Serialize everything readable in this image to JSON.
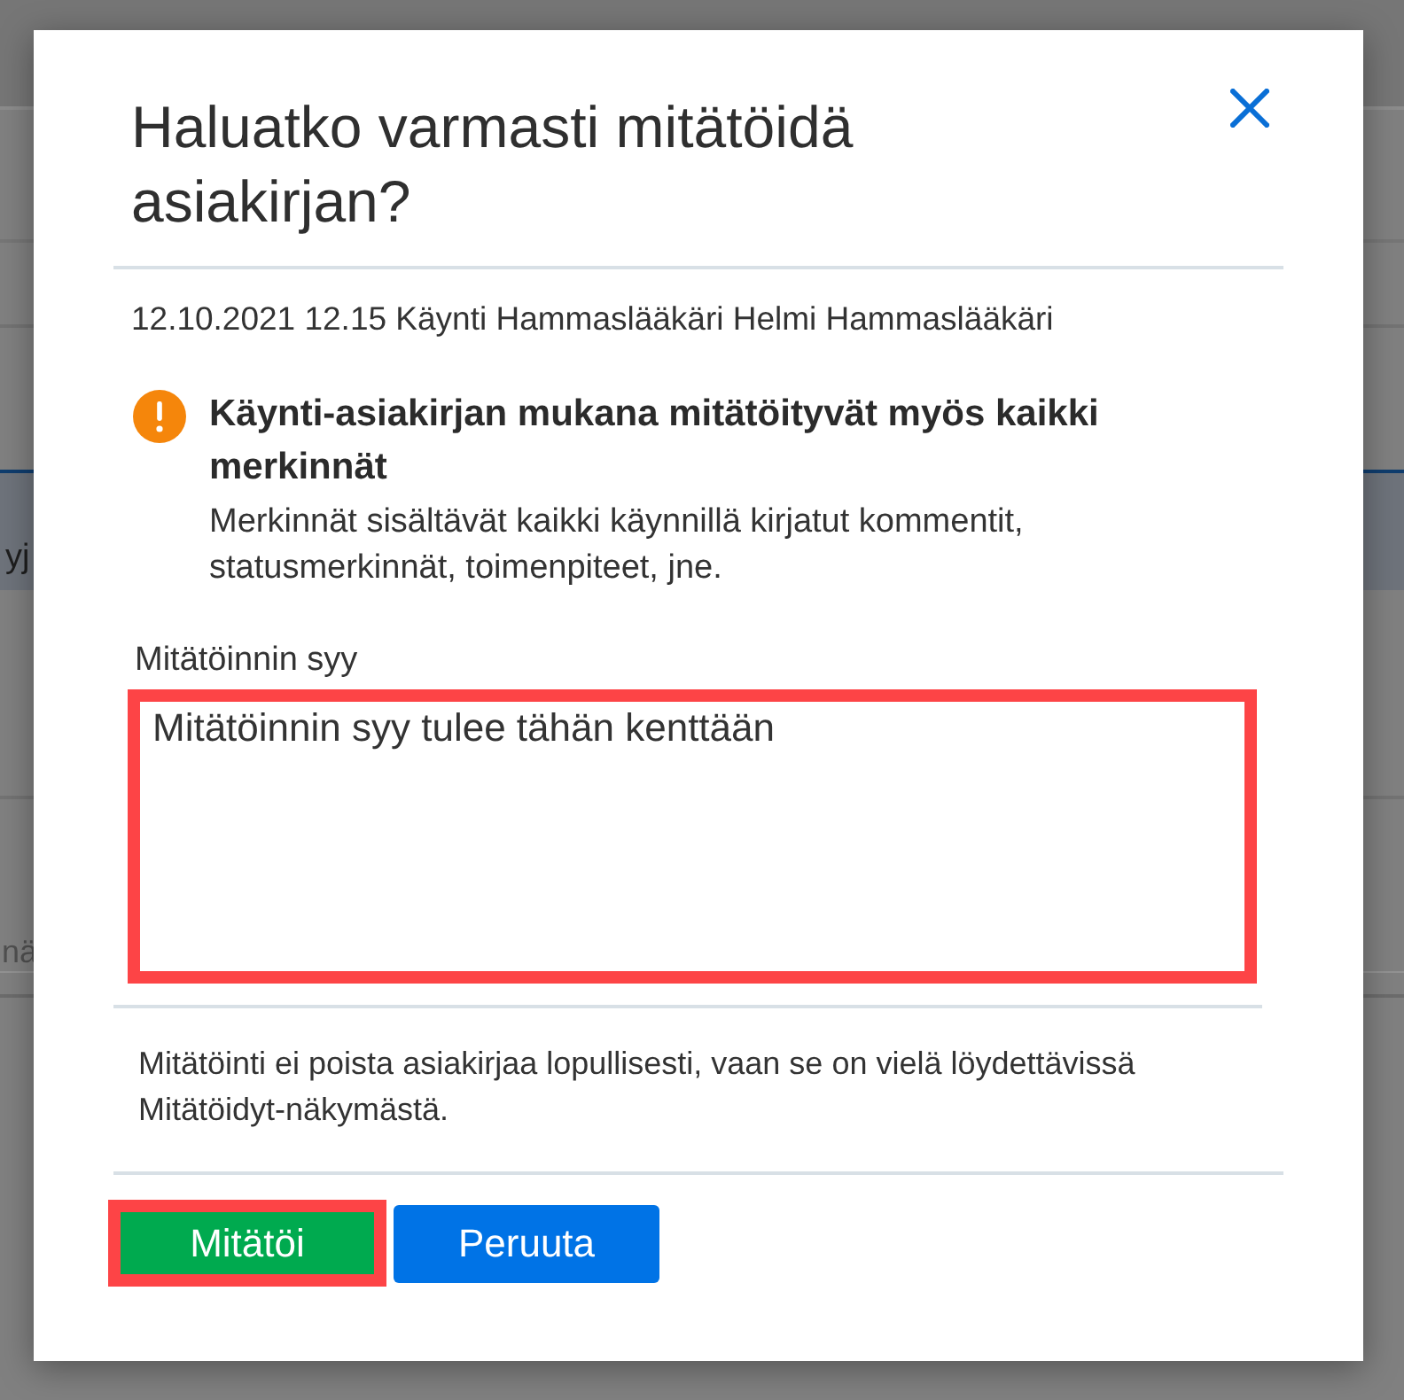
{
  "background": {
    "row_text": "yj",
    "field_text": "nä"
  },
  "dialog": {
    "title": "Haluatko varmasti mitätöidä asiakirjan?",
    "subtitle": "12.10.2021 12.15 Käynti Hammaslääkäri Helmi Hammaslääkäri",
    "warning": {
      "title": "Käynti-asiakirjan mukana mitätöityvät myös kaikki merkinnät",
      "text": "Merkinnät sisältävät kaikki käynnillä kirjatut kommentit, statusmerkinnät, toimenpiteet, jne."
    },
    "reason_field": {
      "label": "Mitätöinnin syy",
      "value": "Mitätöinnin syy tulee tähän kenttään",
      "highlighted": true
    },
    "note": "Mitätöinti ei poista asiakirjaa lopullisesti, vaan se on vielä löydettävissä Mitätöidyt-näkymästä.",
    "buttons": [
      {
        "label": "Mitätöi",
        "kind": "confirm",
        "highlighted": true
      },
      {
        "label": "Peruuta",
        "kind": "cancel",
        "highlighted": false
      }
    ]
  }
}
